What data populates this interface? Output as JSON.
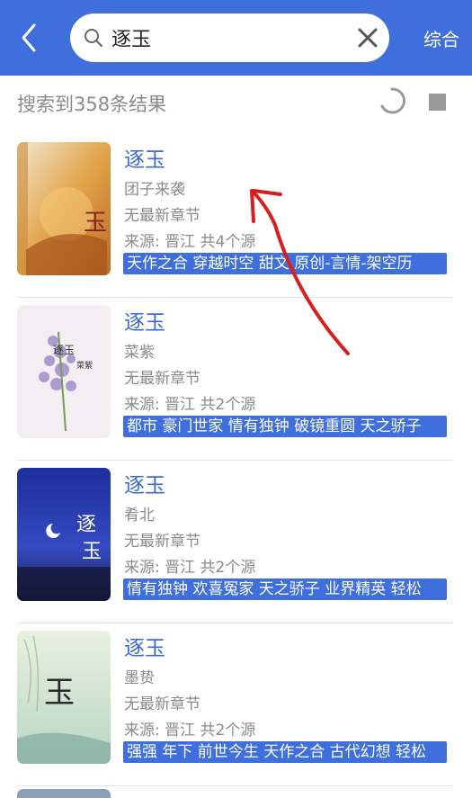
{
  "header": {
    "search_value": "逐玉",
    "sort_label": "综合"
  },
  "status": {
    "result_count": "搜索到358条结果"
  },
  "books": [
    {
      "title": "逐玉",
      "author": "团子来袭",
      "chapter": "无最新章节",
      "source": "来源: 晋江  共4个源",
      "tags": "天作之合 穿越时空 甜文 原创-言情-架空历"
    },
    {
      "title": "逐玉",
      "author": "菜紫",
      "chapter": "无最新章节",
      "source": "来源: 晋江  共2个源",
      "tags": "都市 豪门世家 情有独钟 破镜重圆 天之骄子"
    },
    {
      "title": "逐玉",
      "author": "肴北",
      "chapter": "无最新章节",
      "source": "来源: 晋江  共2个源",
      "tags": "情有独钟 欢喜冤家 天之骄子 业界精英 轻松"
    },
    {
      "title": "逐玉",
      "author": "墨贽",
      "chapter": "无最新章节",
      "source": "来源: 晋江  共2个源",
      "tags": "强强 年下 前世今生 天作之合 古代幻想 轻松"
    }
  ],
  "colors": {
    "accent": "#3f6fdc",
    "annotation": "#d62020"
  }
}
